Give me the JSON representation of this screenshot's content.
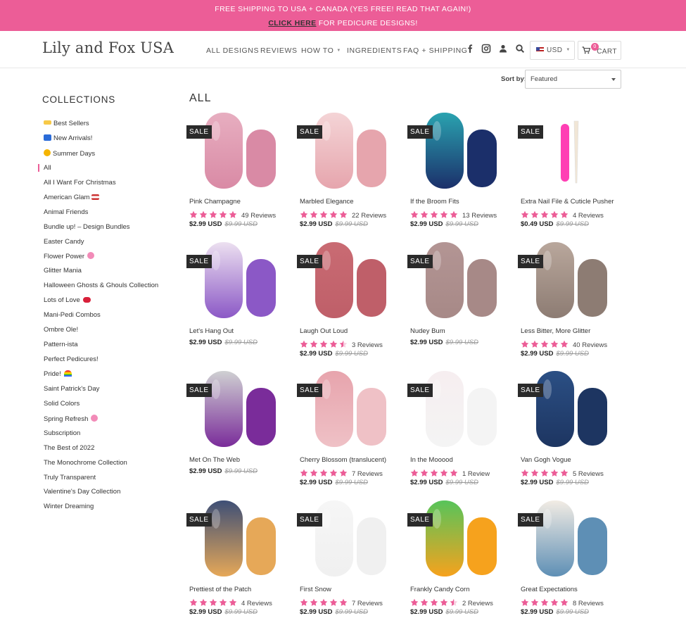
{
  "announcement": {
    "line1": "FREE SHIPPING TO USA + CANADA (YES FREE! READ THAT AGAIN!)",
    "link": "CLICK HERE",
    "line2_rest": " FOR PEDICURE DESIGNS!"
  },
  "header": {
    "logo": "Lily and Fox USA",
    "nav": [
      "ALL DESIGNS",
      "REVIEWS",
      "HOW TO",
      "INGREDIENTS",
      "FAQ + SHIPPING"
    ],
    "currency": "USD",
    "cart_count": "0",
    "cart_label": "CART"
  },
  "sort": {
    "label": "Sort by:",
    "value": "Featured"
  },
  "sidebar": {
    "title": "COLLECTIONS",
    "items": [
      "Best Sellers",
      "New Arrivals!",
      "Summer Days",
      "All",
      "All I Want For Christmas",
      "American Glam",
      "Animal Friends",
      "Bundle up! – Design Bundles",
      "Easter Candy",
      "Flower Power",
      "Glitter Mania",
      "Halloween Ghosts & Ghouls Collection",
      "Lots of Love",
      "Mani-Pedi Combos",
      "Ombre Ole!",
      "Pattern-ista",
      "Perfect Pedicures!",
      "Pride!",
      "Saint Patrick's Day",
      "Solid Colors",
      "Spring Refresh",
      "Subscription",
      "The Best of 2022",
      "The Monochrome Collection",
      "Truly Transparent",
      "Valentine's Day Collection",
      "Winter Dreaming"
    ]
  },
  "main": {
    "title": "ALL",
    "sale_label": "SALE",
    "products": [
      {
        "name": "Pink Champagne",
        "stars": 5,
        "reviews": "49 Reviews",
        "price": "$2.99 USD",
        "was": "$9.99 USD",
        "c1": "#e7aec0",
        "c2": "#d98aa5"
      },
      {
        "name": "Marbled Elegance",
        "stars": 5,
        "reviews": "22 Reviews",
        "price": "$2.99 USD",
        "was": "$9.99 USD",
        "c1": "#f4d4d6",
        "c2": "#e6a5ad"
      },
      {
        "name": "If the Broom Fits",
        "stars": 5,
        "reviews": "13 Reviews",
        "price": "$2.99 USD",
        "was": "$9.99 USD",
        "c1": "#2aa3b0",
        "c2": "#1b2f6a"
      },
      {
        "name": "Extra Nail File & Cuticle Pusher",
        "stars": 5,
        "reviews": "4 Reviews",
        "price": "$0.49 USD",
        "was": "$9.99 USD",
        "c1": "#ff3fb4",
        "c2": "#f1e6d6"
      },
      {
        "name": "Let's Hang Out",
        "stars": 0,
        "reviews": "",
        "price": "$2.99 USD",
        "was": "$9.99 USD",
        "c1": "#ece0f0",
        "c2": "#8b58c6"
      },
      {
        "name": "Laugh Out Loud",
        "stars": 4.5,
        "reviews": "3 Reviews",
        "price": "$2.99 USD",
        "was": "$9.99 USD",
        "c1": "#c96b73",
        "c2": "#bf5f69"
      },
      {
        "name": "Nudey Bum",
        "stars": 0,
        "reviews": "",
        "price": "$2.99 USD",
        "was": "$9.99 USD",
        "c1": "#b39594",
        "c2": "#a78987"
      },
      {
        "name": "Less Bitter, More Glitter",
        "stars": 5,
        "reviews": "40 Reviews",
        "price": "$2.99 USD",
        "was": "$9.99 USD",
        "c1": "#b9a79c",
        "c2": "#8d7c73"
      },
      {
        "name": "Met On The Web",
        "stars": 0,
        "reviews": "",
        "price": "$2.99 USD",
        "was": "$9.99 USD",
        "c1": "#cfd0d2",
        "c2": "#7a2c9a"
      },
      {
        "name": "Cherry Blossom (translucent)",
        "stars": 5,
        "reviews": "7 Reviews",
        "price": "$2.99 USD",
        "was": "$9.99 USD",
        "c1": "#e7a4ad",
        "c2": "#efc1c6"
      },
      {
        "name": "In the Mooood",
        "stars": 5,
        "reviews": "1 Review",
        "price": "$2.99 USD",
        "was": "$9.99 USD",
        "c1": "#f6eef0",
        "c2": "#f4f4f4"
      },
      {
        "name": "Van Gogh Vogue",
        "stars": 5,
        "reviews": "5 Reviews",
        "price": "$2.99 USD",
        "was": "$9.99 USD",
        "c1": "#2b4f84",
        "c2": "#1d3561"
      },
      {
        "name": "Prettiest of the Patch",
        "stars": 5,
        "reviews": "4 Reviews",
        "price": "$2.99 USD",
        "was": "$9.99 USD",
        "c1": "#3e4f76",
        "c2": "#e6a858"
      },
      {
        "name": "First Snow",
        "stars": 5,
        "reviews": "7 Reviews",
        "price": "$2.99 USD",
        "was": "$9.99 USD",
        "c1": "#f6f6f6",
        "c2": "#f0f0f0"
      },
      {
        "name": "Frankly Candy Corn",
        "stars": 4.5,
        "reviews": "2 Reviews",
        "price": "$2.99 USD",
        "was": "$9.99 USD",
        "c1": "#57c45a",
        "c2": "#f6a21d"
      },
      {
        "name": "Great Expectations",
        "stars": 5,
        "reviews": "8 Reviews",
        "price": "$2.99 USD",
        "was": "$9.99 USD",
        "c1": "#f2ece4",
        "c2": "#5e8fb5"
      }
    ]
  },
  "colors": {
    "brand_pink": "#ec5d97",
    "star_pink": "#ec5d97"
  }
}
